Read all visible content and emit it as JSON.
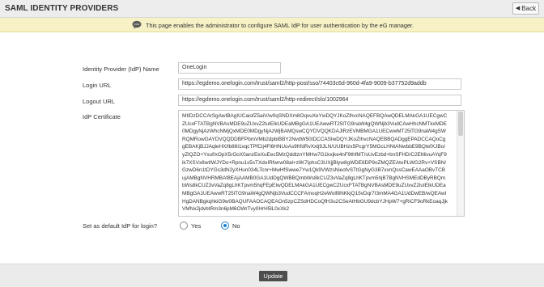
{
  "header": {
    "title": "SAML IDENTITY PROVIDERS",
    "back_label": "Back"
  },
  "info": {
    "text": "This page enables the administrator to configure SAML IdP for user authentication by the eG manager."
  },
  "form": {
    "idp_name": {
      "label": "Identity Provider (IdP) Name",
      "value": "OneLogin"
    },
    "login_url": {
      "label": "Login URL",
      "value": "https://egdemo.onelogin.com/trust/saml2/http-post/sso/74403c6d-960d-4fa9-9009-b37752d9addb"
    },
    "logout_url": {
      "label": "Logout URL",
      "value": "https://egdemo.onelogin.com/trust/saml2/http-redirect/slo/1002964"
    },
    "certificate": {
      "label": "IdP Certificate",
      "value": "MIIDzDCCArSgAwIBAgIUCaiofZ5aiV/w0qSNDXm8OqvuXeYwDQYJKoZIhvcNAQEFBQAwQDELMAkGA1UECgwCZUcxFTATBgNVBAsMDE9uZUxvZ2luIElkUDEaMBgGA1UEAwwRT25lTG9naW4gQWNjb3VudCAwHhcNMTkxMDE0MDgyNjAzWhcNMjQxMDE0MDgyNjAzWjBAMQswCQYDVQQKDAJlRzEVMBMGA1UECwwMT25lTG9naW4gSWRQMRowGAYDVQQDDBFPbmVMb2dpbiBBY2NvdW50IDCCASIwDQYJKoZIhvcNAQEBBQADggEPADCCAQoCggEBAKjBJJAqleHX/lb86I1xqcTPfCij4Fl6HNUoAs9frfdRvXxtj9JLN/UUBHzx5PcgrY5MGcLHNtANwbbE9BQtefXJBo/yZlQZO+Yxuf/xOpX5rOoX0anzEeXuEec5MzQddtznYMHw7G1kxjke4nF9thfMT/oUvEzbd+bnSFHD/C2EMivuAYqF9ik7XSVx8wtIWJYDo+Rpnu1s5sTXdoIRfwrw08al+zlIK7iphsC3UXjjBlyw8gWDE8DP9oZMQZEAtoPLWG2Rv+VSBN/GzwD6n1tDYGs3dN2yXHun034LTcnr+MwHfSwwe7Yw1Qk9VWzsNieofvSTtGgNyG3B7xxnQssCawEAAaOBvTCBujAMBgNVHRMBAf8EAjAAMB0GA1UdDgQWBBQmbWs8kCUZ3vVaZq8gLhKTpvm5hjB7BgNVHSMEdDByRBQmbWs8kCUZ3vVaZq8gLhKTpvm5hqFEpEIwQDELMAkGA1UECgwCZUcxFTATBgNVBAsMDE9uZUxvZ2luIElkUDEaMBgGA1UEAwwRT25lTG9naW4gQWNjb3VudCCCFAmoqH2eWolf8NKkjQ15vDqr7I3mMA4GA1UdDwEB/wQEAwIHgDANBgkqhkiG9w0BAQUFAAOCAQEAOn5zpCZSdHDCoQfH3u2CSeAtHbGU9dcbYJHpW7+gRiCF9oRkEoaqJjkVMNx2jdvbtRm3n6pM6OWrTvy0HrH5lL0xXk2"
    },
    "default_idp": {
      "label": "Set as default IdP for login?",
      "options": [
        "Yes",
        "No"
      ],
      "selected": "No"
    }
  },
  "footer": {
    "update_label": "Update"
  }
}
